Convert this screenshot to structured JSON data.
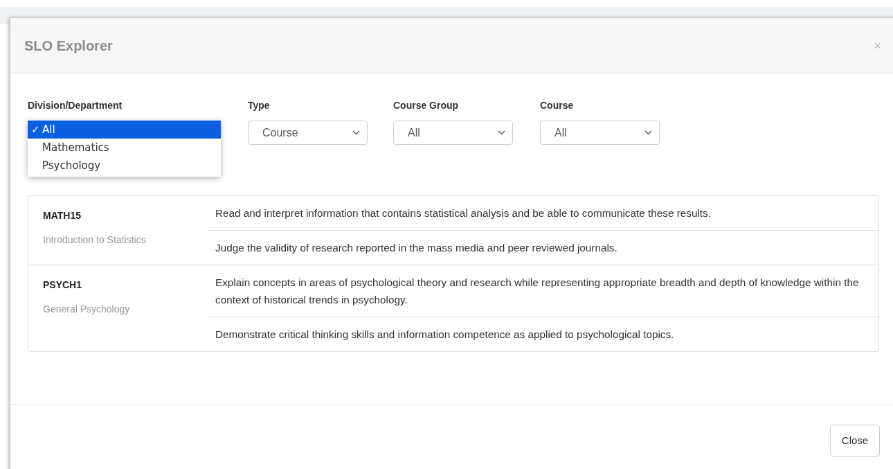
{
  "dialog": {
    "title": "SLO Explorer",
    "close_icon": "×"
  },
  "filters": [
    {
      "label": "Division/Department",
      "kind": "open-list",
      "options": [
        {
          "label": "All",
          "mark": "✓",
          "selected": true
        },
        {
          "label": "Mathematics",
          "selected": false
        },
        {
          "label": "Psychology",
          "selected": false
        }
      ]
    },
    {
      "label": "Type",
      "kind": "select",
      "value": "Course"
    },
    {
      "label": "Course Group",
      "kind": "select",
      "value": "All"
    },
    {
      "label": "Course",
      "kind": "select",
      "value": "All"
    }
  ],
  "courses": [
    {
      "code": "MATH15",
      "title": "Introduction to Statistics",
      "outcomes": [
        "Read and interpret information that contains statistical analysis and be able to communicate these results.",
        "Judge the validity of research reported in the mass media and peer reviewed journals."
      ]
    },
    {
      "code": "PSYCH1",
      "title": "General Psychology",
      "outcomes": [
        "Explain concepts in areas of psychological theory and research while representing appropriate breadth and depth of knowledge within the context of historical trends in psychology.",
        "Demonstrate critical thinking skills and information competence as applied to psychological topics."
      ]
    }
  ],
  "footer": {
    "button": "Close"
  }
}
